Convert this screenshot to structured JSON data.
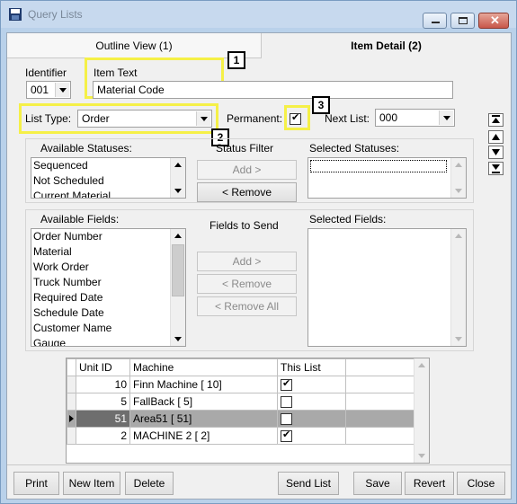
{
  "window": {
    "title": "Query Lists",
    "icon": "app-icon"
  },
  "tabs": [
    {
      "label": "Outline View (1)"
    },
    {
      "label": "Item Detail (2)"
    }
  ],
  "identifier": {
    "label": "Identifier",
    "value": "001"
  },
  "item_text": {
    "label": "Item Text",
    "value": "Material Code"
  },
  "list_type": {
    "label": "List Type:",
    "value": "Order"
  },
  "permanent": {
    "label": "Permanent:",
    "checked": true
  },
  "next_list": {
    "label": "Next List:",
    "value": "000"
  },
  "callouts": [
    "1",
    "2",
    "3"
  ],
  "status_filter": {
    "available_label": "Available Statuses:",
    "title": "Status Filter",
    "selected_label": "Selected Statuses:",
    "available": [
      "Sequenced",
      "Not Scheduled",
      "Current Material"
    ],
    "add_button": "Add >",
    "remove_button": "< Remove"
  },
  "fields": {
    "available_label": "Available Fields:",
    "title": "Fields to Send",
    "selected_label": "Selected Fields:",
    "available": [
      "Order Number",
      "Material",
      "Work Order",
      "Truck Number",
      "Required Date",
      "Schedule Date",
      "Customer Name",
      "Gauge"
    ],
    "add_button": "Add >",
    "remove_button": "< Remove",
    "remove_all_button": "< Remove All"
  },
  "grid": {
    "columns": [
      "Unit ID",
      "Machine",
      "This List"
    ],
    "rows": [
      {
        "unit_id": "10",
        "machine": "Finn Machine   [ 10]",
        "this_list": true
      },
      {
        "unit_id": "5",
        "machine": "FallBack   [ 5]",
        "this_list": false
      },
      {
        "unit_id": "51",
        "machine": "Area51   [ 51]",
        "this_list": false,
        "selected": true
      },
      {
        "unit_id": "2",
        "machine": "MACHINE 2   [ 2]",
        "this_list": true
      }
    ]
  },
  "buttons": {
    "print": "Print",
    "new_item": "New Item",
    "delete": "Delete",
    "send_list": "Send List",
    "save": "Save",
    "revert": "Revert",
    "close": "Close"
  },
  "colors": {
    "highlight": "#f5f047",
    "selected_row": "#a9a9a9",
    "titlebar": "#c7d9ee"
  }
}
